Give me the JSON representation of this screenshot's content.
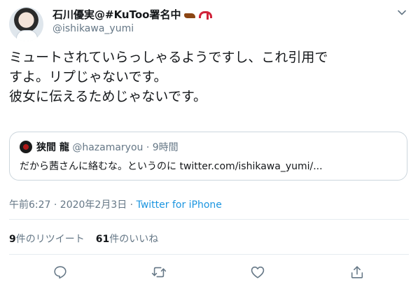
{
  "author": {
    "display_name": "石川優実@#KuToo署名中",
    "emoji": [
      "brown-shoe",
      "red-high-heel"
    ],
    "handle": "@ishikawa_yumi"
  },
  "tweet": {
    "lines": [
      "ミュートされていらっしゃるようですし、これ引用で",
      "すよ。リプじゃないです。",
      "彼女に伝えるためじゃないです。"
    ]
  },
  "quote": {
    "name": "狭間 龍",
    "handle": "@hazamaryou",
    "time": " · 9時間",
    "text": "だから茜さんに絡むな。というのに twitter.com/ishikawa_yumi/..."
  },
  "meta": {
    "datetime": "午前6:27 · 2020年2月3日 · ",
    "app": "Twitter for iPhone"
  },
  "stats": {
    "retweets_count": "9",
    "retweets_label": "件のリツイート",
    "likes_count": "61",
    "likes_label": "件のいいね"
  },
  "actions": [
    "reply-icon",
    "retweet-icon",
    "like-icon",
    "share-icon"
  ],
  "colors": {
    "text": "#14171a",
    "secondary": "#657786",
    "link": "#1b95e0",
    "border": "#e6ecf0"
  }
}
